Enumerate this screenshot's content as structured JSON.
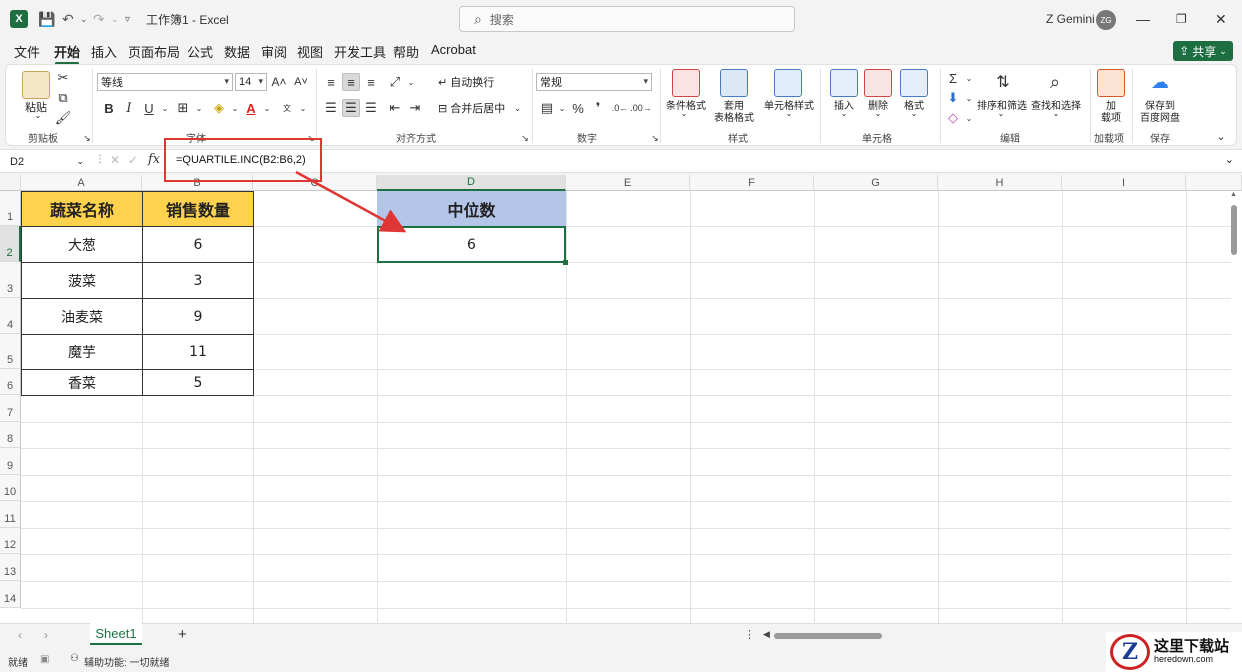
{
  "titlebar": {
    "app_logo": "X",
    "title": "工作簿1 - Excel",
    "search_placeholder": "搜索",
    "user_name": "Z Gemini",
    "avatar_initials": "ZG"
  },
  "menu": {
    "tabs": [
      "文件",
      "开始",
      "插入",
      "页面布局",
      "公式",
      "数据",
      "审阅",
      "视图",
      "开发工具",
      "帮助",
      "Acrobat"
    ],
    "active_tab": "开始",
    "share_label": "共享"
  },
  "ribbon": {
    "clipboard": {
      "paste": "粘贴",
      "group": "剪贴板"
    },
    "font": {
      "font_name": "等线",
      "font_size": "14",
      "group": "字体"
    },
    "alignment": {
      "wrap": "自动换行",
      "merge": "合并后居中",
      "group": "对齐方式"
    },
    "number": {
      "format": "常规",
      "group": "数字"
    },
    "styles": {
      "conditional": "条件格式",
      "table_format_1": "套用",
      "table_format_2": "表格格式",
      "cell_style": "单元格样式",
      "group": "样式"
    },
    "cells": {
      "insert": "插入",
      "delete": "删除",
      "format": "格式",
      "group": "单元格"
    },
    "editing": {
      "sort_filter": "排序和筛选",
      "find_select": "查找和选择",
      "group": "编辑"
    },
    "addins": {
      "label_1": "加",
      "label_2": "载项",
      "group": "加载项"
    },
    "save": {
      "label_1": "保存到",
      "label_2": "百度网盘",
      "group": "保存"
    }
  },
  "formula_bar": {
    "name_box": "D2",
    "fx": "fx",
    "formula": "=QUARTILE.INC(B2:B6,2)"
  },
  "sheet": {
    "columns": [
      "A",
      "B",
      "C",
      "D",
      "E",
      "F",
      "G",
      "H",
      "I"
    ],
    "rows": [
      "1",
      "2",
      "3",
      "4",
      "5",
      "6",
      "7",
      "8",
      "9",
      "10",
      "11",
      "12",
      "13",
      "14"
    ],
    "table_header": {
      "name": "蔬菜名称",
      "qty": "销售数量"
    },
    "table_rows": [
      {
        "name": "大葱",
        "qty": "6"
      },
      {
        "name": "菠菜",
        "qty": "3"
      },
      {
        "name": "油麦菜",
        "qty": "9"
      },
      {
        "name": "魔芋",
        "qty": "11"
      },
      {
        "name": "香菜",
        "qty": "5"
      }
    ],
    "median_header": "中位数",
    "median_value": "6",
    "selected_cell": "D2"
  },
  "sheet_tabs": {
    "active": "Sheet1",
    "add": "+"
  },
  "status": {
    "ready": "就绪",
    "accessibility": "辅助功能: 一切就绪"
  },
  "watermark": {
    "logo": "Z",
    "cn": "这里下载站",
    "en": "heredown.com"
  },
  "colors": {
    "accent": "#1d6f42",
    "header_fill": "#ffd24d",
    "median_fill": "#b4c6e7",
    "callout": "#e03535"
  }
}
